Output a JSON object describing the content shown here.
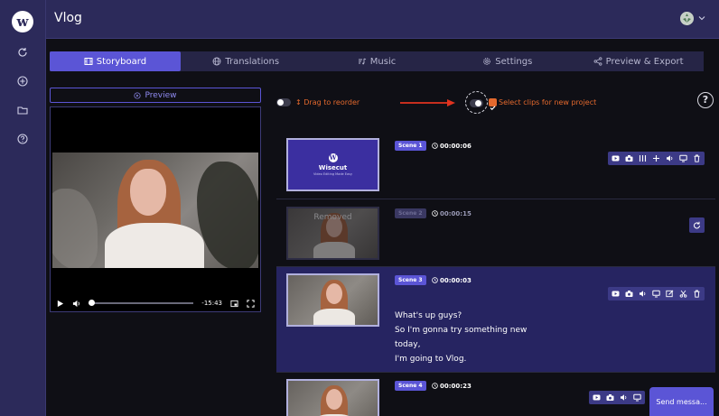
{
  "rail": {
    "logo": "w",
    "items": [
      {
        "icon": "refresh-icon"
      },
      {
        "icon": "plus-circle-icon"
      },
      {
        "icon": "folder-icon"
      },
      {
        "icon": "help-circle-icon"
      }
    ]
  },
  "header": {
    "title": "Vlog"
  },
  "tabs": [
    {
      "label": "Storyboard",
      "icon": "film-icon",
      "active": true
    },
    {
      "label": "Translations",
      "icon": "globe-icon",
      "active": false
    },
    {
      "label": "Music",
      "icon": "music-icon",
      "active": false
    },
    {
      "label": "Settings",
      "icon": "gear-icon",
      "active": false
    },
    {
      "label": "Preview & Export",
      "icon": "share-icon",
      "active": false
    }
  ],
  "preview": {
    "button_label": "Preview",
    "time_left": "-15:43",
    "progress": 0.0
  },
  "toolbar": {
    "drag_label": "Drag to reorder",
    "select_label": "Select clips for new project",
    "help_label": "?"
  },
  "thumbnail_brand": {
    "logo": "W",
    "name": "Wisecut",
    "tagline": "Video Editing Made Easy"
  },
  "scenes": [
    {
      "badge": "Scene 1",
      "duration": "00:00:06",
      "removed": false,
      "transcript": []
    },
    {
      "badge": "Scene 2",
      "duration": "00:00:15",
      "removed": true,
      "removed_label": "Removed",
      "transcript": []
    },
    {
      "badge": "Scene 3",
      "duration": "00:00:03",
      "removed": false,
      "transcript": [
        "What's up guys?",
        "So I'm gonna try something new",
        "today,",
        "I'm going to Vlog."
      ]
    },
    {
      "badge": "Scene 4",
      "duration": "00:00:23",
      "removed": false,
      "transcript": []
    }
  ],
  "chat": {
    "label": "Send messa..."
  },
  "colors": {
    "accent": "#5b55d6",
    "sidebar": "#2c2a5a",
    "orange": "#e4692d",
    "selected_row": "#262461"
  }
}
